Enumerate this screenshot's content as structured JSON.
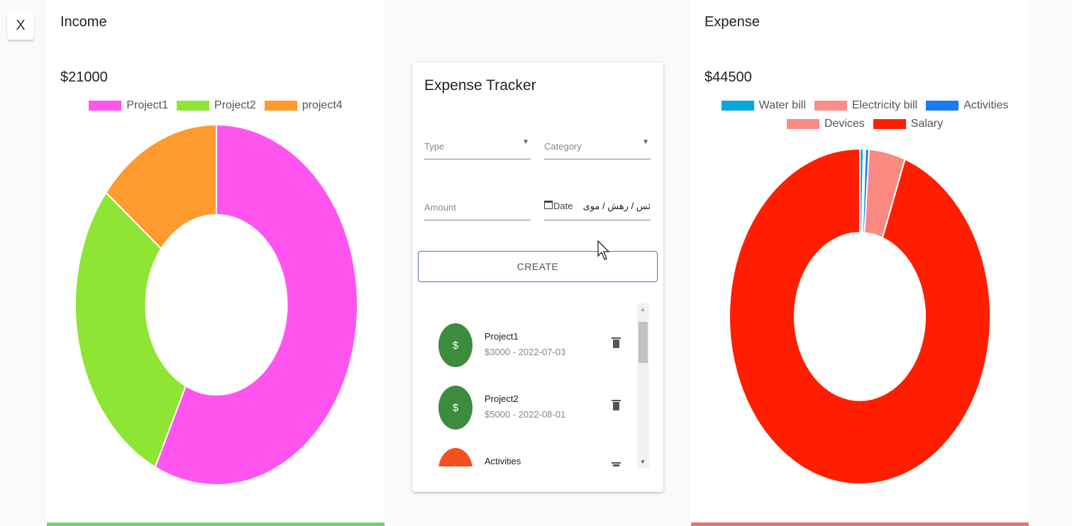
{
  "close_button": {
    "label": "X"
  },
  "income": {
    "title": "Income",
    "total": "$21000",
    "bar_color": "#72d572"
  },
  "expense": {
    "title": "Expense",
    "total": "$44500",
    "bar_color": "#e57373"
  },
  "tracker": {
    "title": "Expense Tracker",
    "type_label": "Type",
    "category_label": "Category",
    "amount_label": "Amount",
    "date_label": "Date",
    "date_value": "ثس / رهش / موی",
    "create_label": "CREATE",
    "transactions": [
      {
        "title": "Project1",
        "subtitle": "$3000 - 2022-07-03",
        "type": "income",
        "icon": "dollar-icon",
        "color": "#3d8b3d"
      },
      {
        "title": "Project2",
        "subtitle": "$5000 - 2022-08-01",
        "type": "income",
        "icon": "dollar-icon",
        "color": "#3d8b3d"
      },
      {
        "title": "Activities",
        "subtitle": "",
        "type": "expense",
        "icon": "dollar-icon",
        "color": "#f4511e"
      }
    ]
  },
  "chart_data": [
    {
      "type": "pie",
      "title": "Income",
      "categories": [
        "Project1",
        "Project2",
        "project4"
      ],
      "values": [
        12000,
        6000,
        3000
      ],
      "colors": [
        "#ff55ee",
        "#8ee534",
        "#ff9a2e"
      ],
      "legend": "top",
      "donut": true
    },
    {
      "type": "pie",
      "title": "Expense",
      "categories": [
        "Water bill",
        "Electricity bill",
        "Activities",
        "Devices",
        "Salary"
      ],
      "values": [
        200,
        100,
        200,
        2000,
        42000
      ],
      "colors": [
        "#06a9d8",
        "#f88e88",
        "#1a7bf0",
        "#fa8a82",
        "#ff1e00"
      ],
      "legend": "top",
      "donut": true
    }
  ]
}
